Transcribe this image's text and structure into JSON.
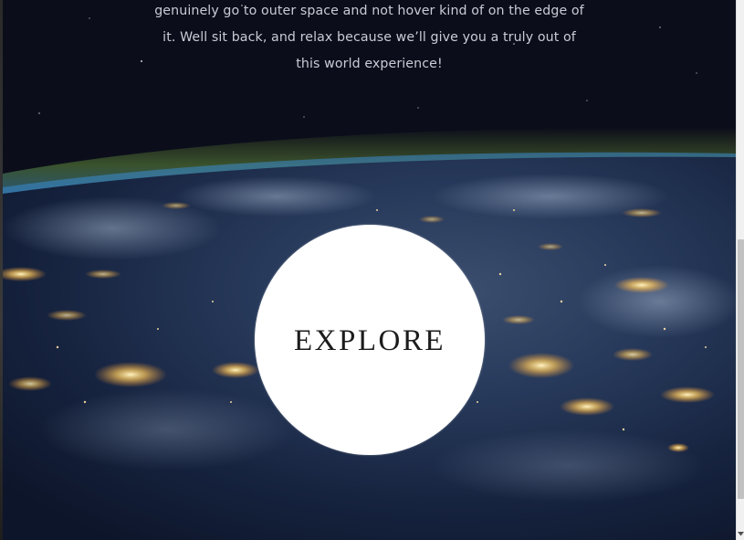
{
  "intro": {
    "line1": "genuinely go to outer space and not hover kind of on the edge of",
    "line2": "it. Well sit back, and relax because we’ll give you a truly out of",
    "line3": "this world experience!"
  },
  "hero": {
    "background": "earth-at-night-from-orbit",
    "explore_label": "EXPLORE"
  },
  "colors": {
    "space": "#0b0e1a",
    "text": "#c9cbd6",
    "circle": "#ffffff",
    "city_lights": "#ffd98a"
  },
  "scrollbar": {
    "icon": "chevron-down-icon"
  }
}
